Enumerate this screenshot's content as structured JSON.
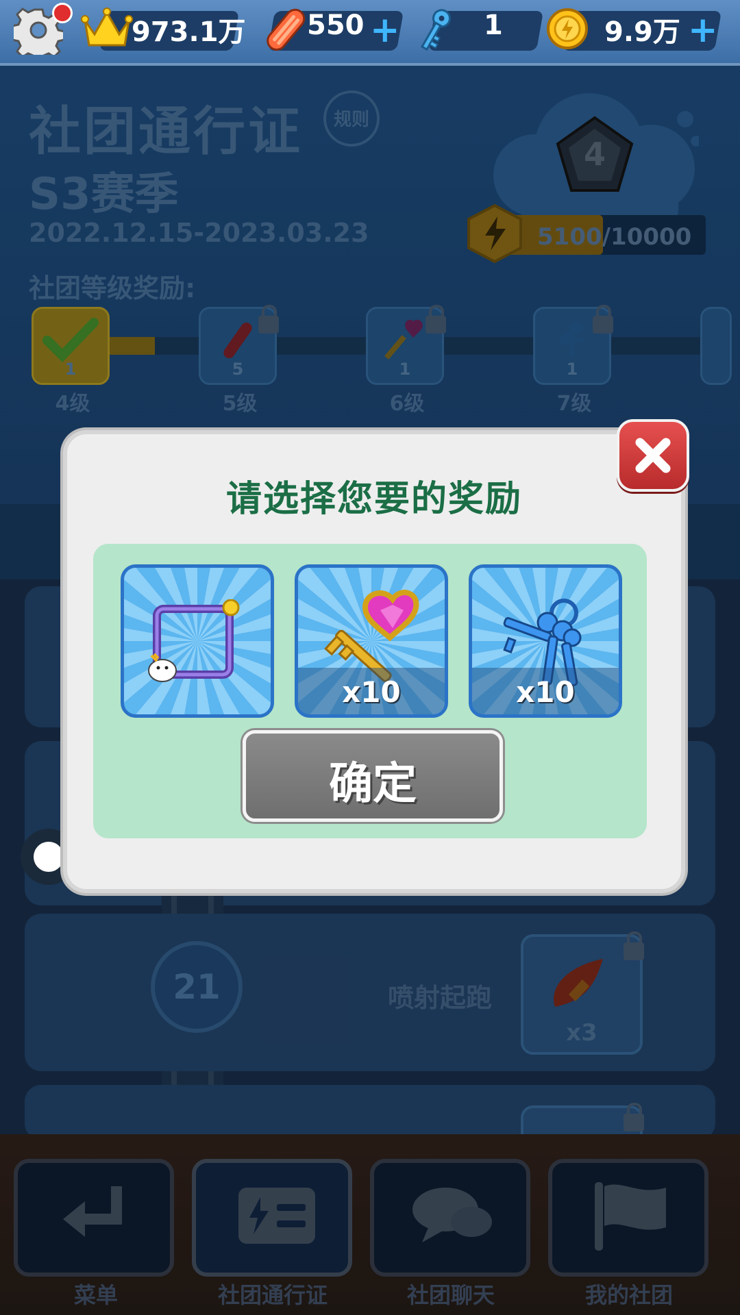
{
  "topbar": {
    "crowns": "973.1万",
    "boards": "550",
    "keys": "1",
    "coins": "9.9万"
  },
  "pass": {
    "title": "社团通行证",
    "rules_label": "规则",
    "season": "S3赛季",
    "dates": "2022.12.15-2023.03.23",
    "rank_level": "4",
    "progress_text": "5100/10000",
    "progress_fraction": 0.51,
    "tier_rewards_title": "社团等级奖励:",
    "tiers": [
      {
        "count": "1",
        "label": "4级"
      },
      {
        "count": "5",
        "label": "5级"
      },
      {
        "count": "1",
        "label": "6级"
      },
      {
        "count": "1",
        "label": "7级"
      }
    ]
  },
  "list": {
    "level_number": "21",
    "reward_name": "喷射起跑",
    "reward_qty": "x3"
  },
  "dialog": {
    "title": "请选择您要的奖励",
    "options": [
      {
        "name": "avatar-frame",
        "qty": ""
      },
      {
        "name": "heart-key",
        "qty": "x10"
      },
      {
        "name": "keys-bundle",
        "qty": "x10"
      }
    ],
    "confirm_label": "确定"
  },
  "nav": {
    "items": [
      {
        "label": "菜单"
      },
      {
        "label": "社团通行证"
      },
      {
        "label": "社团聊天"
      },
      {
        "label": "我的社团"
      }
    ]
  },
  "colors": {
    "dialog_title": "#1b6e46",
    "close_button": "#d23b3b",
    "confirm_button": "#7d7d7d",
    "reward_panel": "#b5e5ca"
  }
}
